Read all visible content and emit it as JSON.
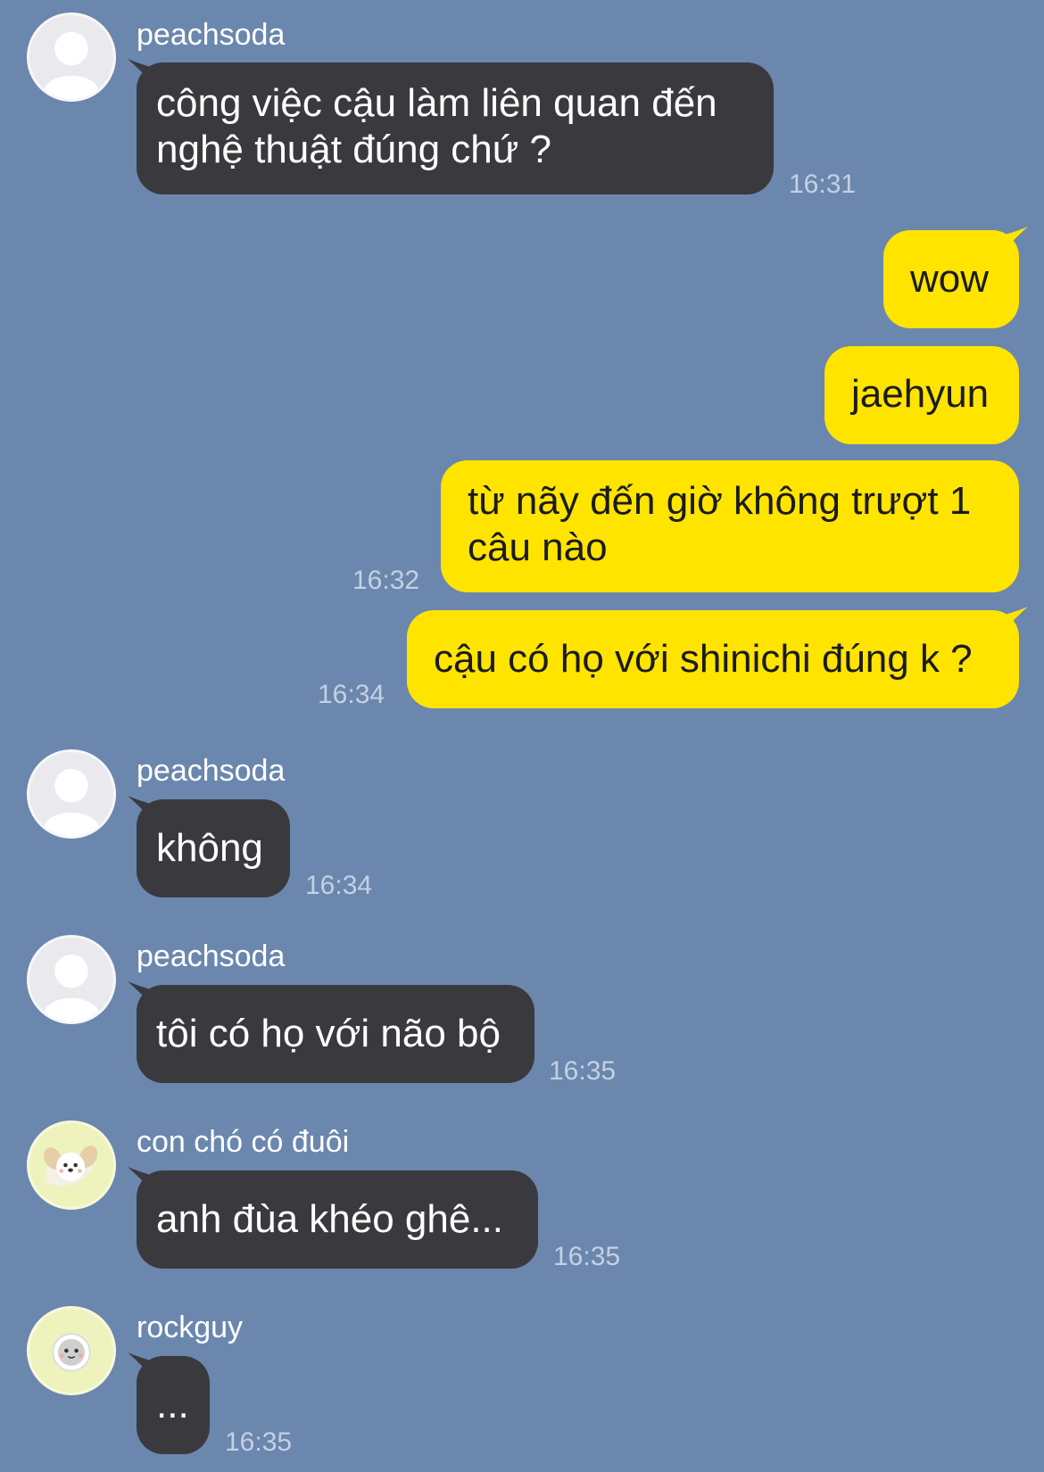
{
  "messages": [
    {
      "sender": "peachsoda",
      "avatar_icon": "default-user-icon",
      "lines": [
        "công việc cậu làm liên quan đến",
        "nghệ thuật đúng chứ ?"
      ],
      "time": "16:31"
    },
    {
      "lines": [
        "wow"
      ]
    },
    {
      "lines": [
        "jaehyun"
      ]
    },
    {
      "lines": [
        "từ nãy đến giờ không trượt 1",
        "câu nào"
      ],
      "time": "16:32"
    },
    {
      "lines": [
        "cậu có họ với shinichi đúng k ?"
      ],
      "time": "16:34"
    },
    {
      "sender": "peachsoda",
      "avatar_icon": "default-user-icon",
      "lines": [
        "không"
      ],
      "time": "16:34"
    },
    {
      "sender": "peachsoda",
      "avatar_icon": "default-user-icon",
      "lines": [
        "tôi có họ với não bộ"
      ],
      "time": "16:35"
    },
    {
      "sender": "con chó có đuôi",
      "avatar_icon": "puppy-avatar-icon",
      "lines": [
        "anh đùa khéo ghê..."
      ],
      "time": "16:35"
    },
    {
      "sender": "rockguy",
      "avatar_icon": "bear-avatar-icon",
      "lines": [
        "..."
      ],
      "time": "16:35"
    }
  ],
  "colors": {
    "background": "#6b87ae",
    "incoming_bubble": "#3a3a3e",
    "outgoing_bubble": "#ffe400",
    "timestamp": "#c4d1e3"
  }
}
